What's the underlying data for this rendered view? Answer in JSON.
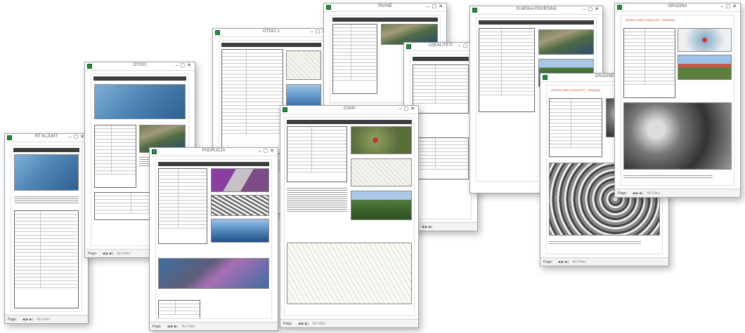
{
  "windows": [
    {
      "id": "w1",
      "title": "RT KLJUNT"
    },
    {
      "id": "w2",
      "title": "OTOCI"
    },
    {
      "id": "w3",
      "title": "PODRUČJA"
    },
    {
      "id": "w4",
      "title": "OTOCI 1"
    },
    {
      "id": "w5",
      "title": "ČVAN"
    },
    {
      "id": "w6",
      "title": "RIVINE"
    },
    {
      "id": "w7",
      "title": "LOKALITETI"
    },
    {
      "id": "w8",
      "title": "ŠUMSKA POVRŠINA"
    },
    {
      "id": "w9",
      "title": "GRADINA"
    },
    {
      "id": "w10",
      "title": "GRADINE"
    }
  ],
  "pager_label": "Page:",
  "no_filter_label": "No Filter",
  "nav_glyphs": "◀ ▶ ▶|",
  "detail_red_text": "ARHEOLOŠKI LOKALITET - GRADINA",
  "icons": {
    "app": "ms-access-icon",
    "window_controls": "minimize-maximize-close-icons"
  }
}
